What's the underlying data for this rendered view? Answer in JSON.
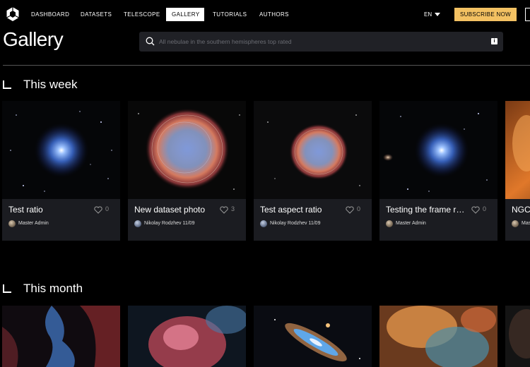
{
  "nav": {
    "items": [
      {
        "label": "DASHBOARD",
        "active": false
      },
      {
        "label": "DATASETS",
        "active": false
      },
      {
        "label": "TELESCOPE",
        "active": false
      },
      {
        "label": "GALLERY",
        "active": true
      },
      {
        "label": "TUTORIALS",
        "active": false
      },
      {
        "label": "AUTHORS",
        "active": false
      }
    ],
    "language": "EN",
    "subscribe_label": "SUBSCRIBE NOW"
  },
  "page_title": "Gallery",
  "search": {
    "placeholder": "All nebulae in the southern hemispheres top rated",
    "info_badge": "i"
  },
  "sections": [
    {
      "title": "This week",
      "cards": [
        {
          "title": "Test ratio",
          "likes": "0",
          "author": "Master Admin",
          "date": "",
          "image": "blue-nebula-star-field"
        },
        {
          "title": "New dataset photo",
          "likes": "3",
          "author": "Nikolay Rodzhev 11/09",
          "image": "red-blue-shell-nebula"
        },
        {
          "title": "Test aspect ratio",
          "likes": "0",
          "author": "Nikolay Rodzhev 11/09",
          "image": "red-blue-shell-nebula-small"
        },
        {
          "title": "Testing the frame ratio",
          "likes": "0",
          "author": "Master Admin",
          "image": "blue-nebula-star-field"
        },
        {
          "title": "NGC",
          "likes": "",
          "author": "Mas",
          "image": "orange-nebula"
        }
      ]
    },
    {
      "title": "This month",
      "cards": [
        {
          "image": "blue-red-nebula"
        },
        {
          "image": "pink-emission-nebula"
        },
        {
          "image": "spiral-galaxy"
        },
        {
          "image": "orange-blue-nebula"
        },
        {
          "image": "dark-nebula"
        }
      ]
    }
  ],
  "colors": {
    "accent": "#f3c162",
    "background": "#000000",
    "card": "#1b1c21",
    "search": "#202126"
  }
}
